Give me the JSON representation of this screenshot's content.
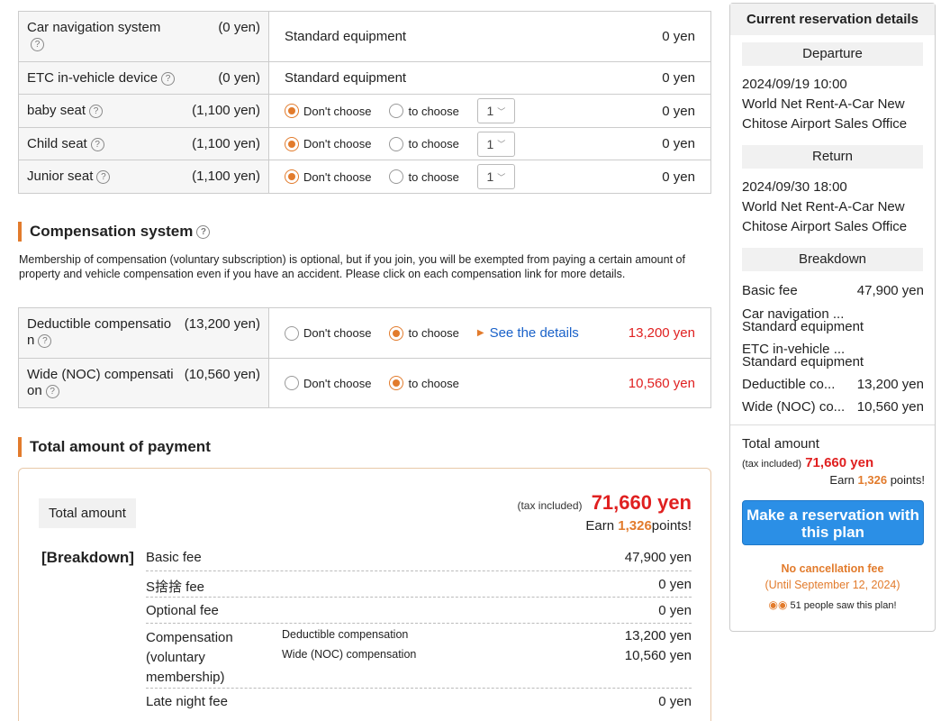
{
  "options": {
    "car_nav": {
      "name": "Car navigation system",
      "price": "(0 yen)",
      "value": "Standard equipment",
      "amount": "0 yen"
    },
    "etc": {
      "name": "ETC in-vehicle device",
      "price": "(0 yen)",
      "value": "Standard equipment",
      "amount": "0 yen"
    },
    "baby": {
      "name": "baby seat",
      "price": "(1,100 yen)",
      "dont": "Don't choose",
      "choose": "to choose",
      "qty": "1",
      "amount": "0 yen"
    },
    "child": {
      "name": "Child seat",
      "price": "(1,100 yen)",
      "dont": "Don't choose",
      "choose": "to choose",
      "qty": "1",
      "amount": "0 yen"
    },
    "junior": {
      "name": "Junior seat",
      "price": "(1,100 yen)",
      "dont": "Don't choose",
      "choose": "to choose",
      "qty": "1",
      "amount": "0 yen"
    }
  },
  "compensation": {
    "heading": "Compensation system",
    "description": "Membership of compensation (voluntary subscription) is optional, but if you join, you will be exempted from paying a certain amount of property and vehicle compensation even if you have an accident. Please click on each compensation link for more details.",
    "deductible": {
      "name": "Deductible compensatio n",
      "price": "(13,200 yen)",
      "dont": "Don't choose",
      "choose": "to choose",
      "link": "See the details",
      "amount": "13,200 yen"
    },
    "noc": {
      "name": "Wide (NOC) compensati on",
      "price": "(10,560 yen)",
      "dont": "Don't choose",
      "choose": "to choose",
      "amount": "10,560 yen"
    }
  },
  "payment": {
    "heading": "Total amount of payment",
    "total_label": "Total amount",
    "tax": "(tax included)",
    "total": "71,660 yen",
    "earn": "Earn",
    "points": "1,326",
    "points_suffix": "points!",
    "breakdown_title": "[Breakdown]",
    "rows": [
      {
        "label": "Basic fee",
        "value": "47,900 yen"
      },
      {
        "label": "S捨捨 fee",
        "value": "0 yen"
      },
      {
        "label": "Optional fee",
        "value": "0 yen"
      },
      {
        "label": "Compensation (voluntary membership)",
        "sub1": "Deductible compensation",
        "sub2": "Wide (NOC) compensation",
        "value1": "13,200 yen",
        "value2": "10,560 yen"
      },
      {
        "label": "Late night fee",
        "value": "0 yen"
      }
    ]
  },
  "sidebar": {
    "title": "Current reservation details",
    "departure_label": "Departure",
    "departure_date": "2024/09/19 10:00",
    "departure_place": "World Net Rent-A-Car New Chitose Airport Sales Office",
    "return_label": "Return",
    "return_date": "2024/09/30 18:00",
    "return_place": "World Net Rent-A-Car New Chitose Airport Sales Office",
    "breakdown_label": "Breakdown",
    "basic_label": "Basic fee",
    "basic_value": "47,900 yen",
    "nav_label": "Car navigation ...",
    "nav_value": "Standard equipment",
    "etc_label": "ETC in-vehicle ...",
    "etc_value": "Standard equipment",
    "ded_label": "Deductible co...",
    "ded_value": "13,200 yen",
    "noc_label": "Wide (NOC) co...",
    "noc_value": "10,560 yen",
    "total_label": "Total amount",
    "tax": "(tax included)",
    "total": "71,660 yen",
    "earn": "Earn",
    "points": "1,326",
    "points_suffix": "points!",
    "cta": "Make a reservation with this plan",
    "no_cancel": "No cancellation fee",
    "until": "(Until September 12, 2024)",
    "viewers": "51 people saw this plan!"
  }
}
